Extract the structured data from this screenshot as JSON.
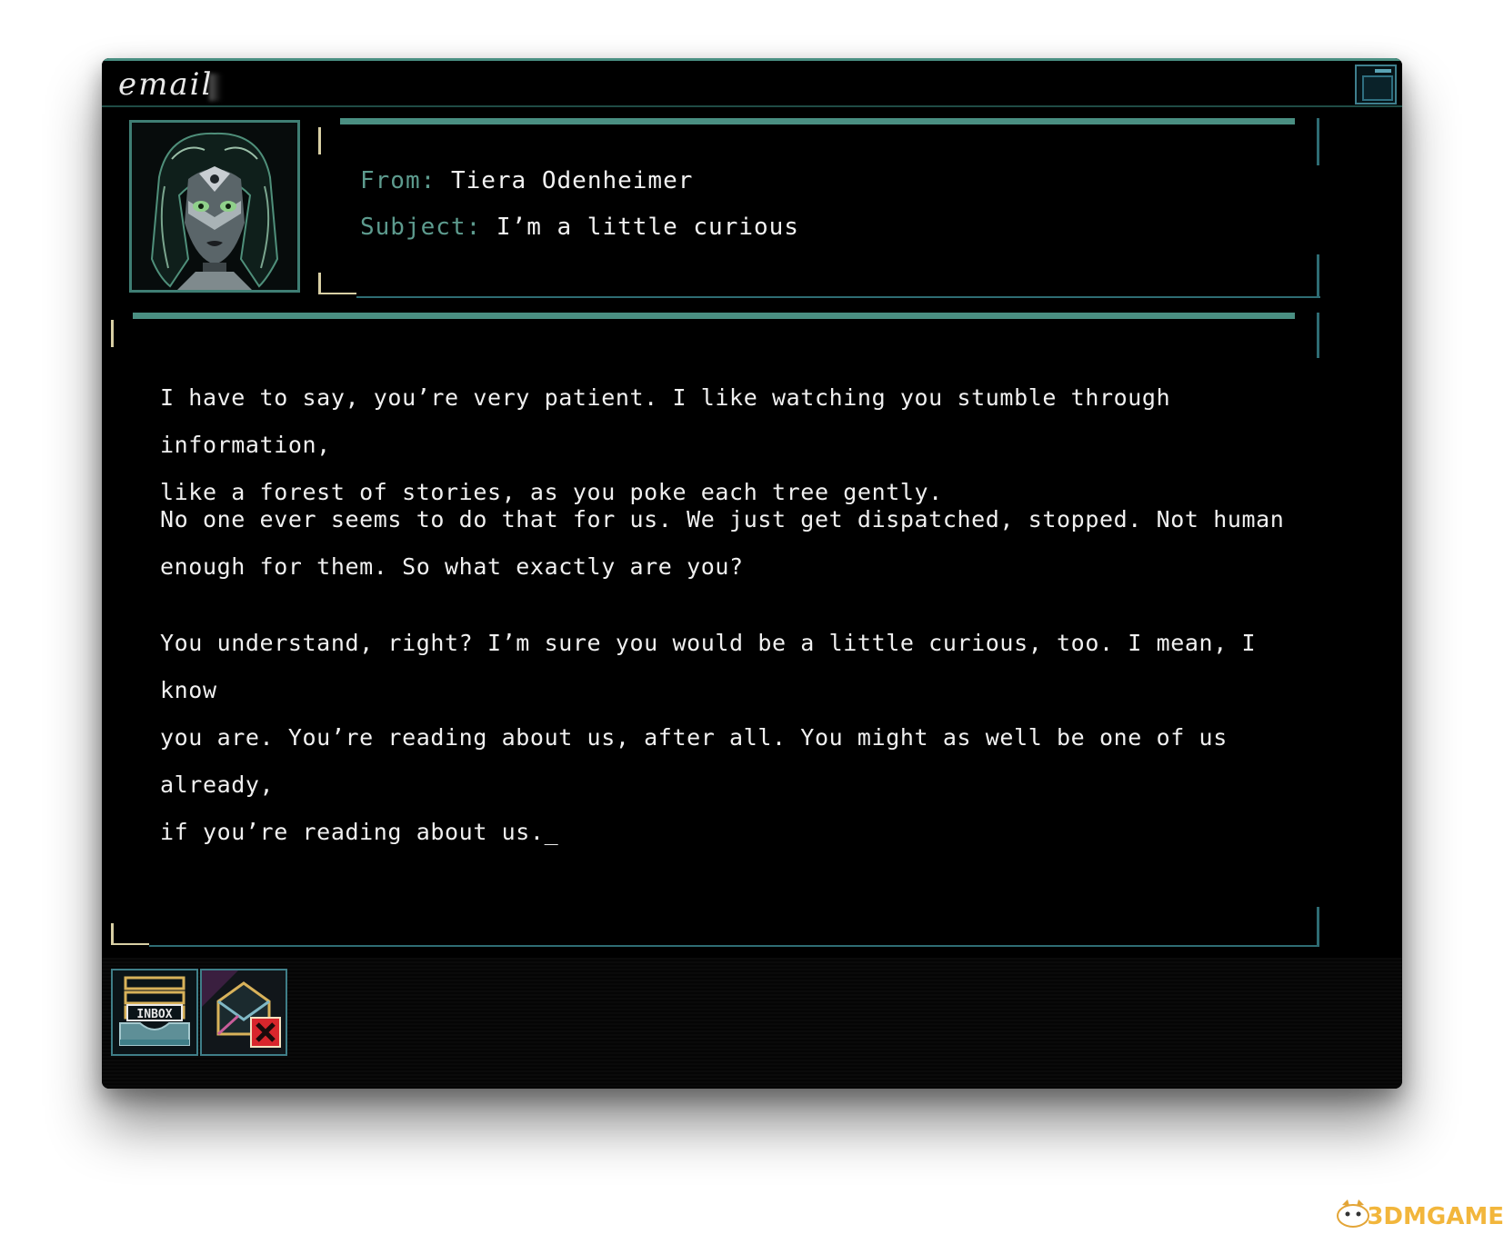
{
  "window": {
    "title": "email"
  },
  "header": {
    "from_label": "From:",
    "from_value": "Tiera Odenheimer",
    "subject_label": "Subject:",
    "subject_value": "I’m a little curious"
  },
  "body": {
    "paragraphs": [
      "I have to say, you’re very patient. I like watching you stumble through information,\nlike a forest of stories, as you poke each tree gently.",
      "No one ever seems to do that for us. We just get dispatched, stopped. Not human\nenough for them. So what exactly are you?",
      "You understand, right? I’m sure you would be a little curious, too. I mean, I know\nyou are. You’re reading about us, after all. You might as well be one of us already,\nif you’re reading about us._"
    ]
  },
  "toolbar": {
    "inbox_label": "INBOX"
  },
  "watermark": {
    "text": "3DMGAME"
  },
  "colors": {
    "accent_teal": "#4a8f82",
    "label_teal": "#5d9b8e",
    "bracket_cream": "#d8cfa4",
    "delete_red": "#d8262c"
  }
}
